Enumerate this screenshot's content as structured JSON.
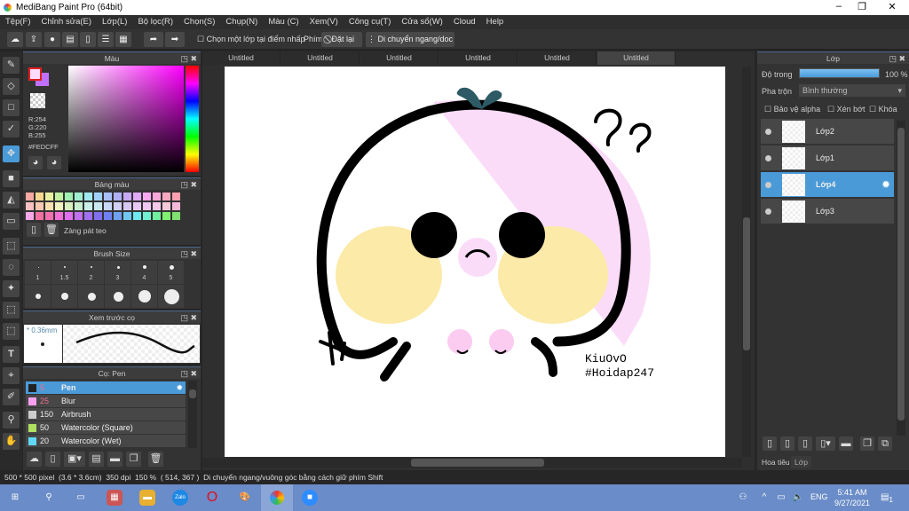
{
  "app": {
    "title": "MediBang Paint Pro (64bit)"
  },
  "menu": [
    "Tệp(F)",
    "Chỉnh sửa(E)",
    "Lớp(L)",
    "Bộ lọc(R)",
    "Chọn(S)",
    "Chụp(N)",
    "Màu (C)",
    "Xem(V)",
    "Công cụ(T)",
    "Cửa sổ(W)",
    "Cloud",
    "Help"
  ],
  "toolbar": {
    "select_layer_checkbox": "Chọn một lớp tại điểm nhấp",
    "key_label": "Phím",
    "reset": "Đặt lại",
    "move_mode": "Di chuyển ngang/doc"
  },
  "color_panel": {
    "title": "Màu",
    "r": "R:254",
    "g": "G:220",
    "b": "B:255",
    "hex": "#FEDCFF",
    "primary": "#FEDCFF",
    "secondary": "#c070ff"
  },
  "palette_panel": {
    "title": "Bảng màu",
    "name": "Zàng pát teo",
    "colors": [
      "#f7a8a0",
      "#f8d890",
      "#e8f0a0",
      "#c0f0a0",
      "#a0f0b0",
      "#a0f0d0",
      "#a0e8f0",
      "#a0d0f8",
      "#a8c0f8",
      "#b0b0f8",
      "#c8a8f8",
      "#e0a8f8",
      "#f8a8f0",
      "#f8a8d8",
      "#f8a8c0",
      "#f8a0b0",
      "#f8c0c0",
      "#f8c8b0",
      "#f8e0b0",
      "#f0f0c0",
      "#d8f0c0",
      "#c8f0d0",
      "#c8f0e8",
      "#c8e8f0",
      "#c8d8f8",
      "#d0d0f8",
      "#d8c8f8",
      "#e8c8f8",
      "#f0c8f0",
      "#f8c8e8",
      "#f8c8d8",
      "#f8b8d8",
      "#f8a8e8",
      "#f070a0",
      "#f070b0",
      "#f070d8",
      "#e070f0",
      "#c070f0",
      "#a070f0",
      "#8070f0",
      "#7080f0",
      "#70a0f0",
      "#70c8f0",
      "#70e8f0",
      "#70f0d0",
      "#70f0a0",
      "#80f070",
      "#80e070"
    ]
  },
  "brush_size_panel": {
    "title": "Brush Size",
    "sizes": [
      "1",
      "1.5",
      "2",
      "3",
      "4",
      "5"
    ]
  },
  "brush_preview_panel": {
    "title": "Xem trước cọ",
    "size": "* 0.36mm"
  },
  "brush_panel": {
    "title": "Cọ: Pen",
    "brushes": [
      {
        "size": "5",
        "name": "Pen",
        "color": "#222222",
        "selected": true
      },
      {
        "size": "25",
        "name": "Blur",
        "color": "#f8a0f0"
      },
      {
        "size": "150",
        "name": "Airbrush",
        "color": "#cccccc"
      },
      {
        "size": "50",
        "name": "Watercolor (Square)",
        "color": "#b0e060"
      },
      {
        "size": "20",
        "name": "Watercolor (Wet)",
        "color": "#60d8f8"
      }
    ]
  },
  "tabs": [
    "Untitled",
    "Untitled",
    "Untitled",
    "Untitled",
    "Untitled",
    "Untitled"
  ],
  "canvas": {
    "signature_1": "KiuOvO",
    "signature_2": "#Hoidap247"
  },
  "layer_panel": {
    "title": "Lớp",
    "opacity_label": "Độ trong",
    "opacity": "100 %",
    "opacity_value": 100,
    "blend_label": "Pha trộn",
    "blend": "Bình thường",
    "protect_alpha": "Bảo vệ alpha",
    "clipping": "Xén bớt",
    "lock": "Khóa",
    "layers": [
      {
        "name": "Lớp2"
      },
      {
        "name": "Lớp1"
      },
      {
        "name": "Lớp4",
        "selected": true
      },
      {
        "name": "Lớp3"
      }
    ],
    "bottom_tabs": [
      "Hoa tiêu",
      "Lớp"
    ]
  },
  "status": {
    "size": "500 * 500 pixel",
    "cm": "(3.6 * 3.6cm)",
    "dpi": "350 dpi",
    "zoom": "150 %",
    "coords": "( 514, 367 )",
    "hint": "Di chuyển ngang/vuông góc bằng cách giữ phím Shift"
  },
  "taskbar": {
    "lang": "ENG",
    "time": "5:41 AM",
    "date": "9/27/2021",
    "notifications": "1"
  }
}
